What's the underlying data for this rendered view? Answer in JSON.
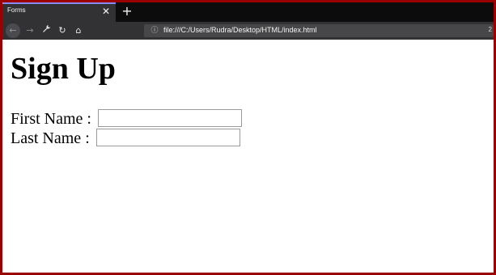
{
  "browser": {
    "tab": {
      "title": "Forms",
      "close_glyph": "✕"
    },
    "new_tab_glyph": "+",
    "nav": {
      "back_icon": "←",
      "forward_icon": "→",
      "tools_icon": "🔧",
      "reload_icon": "↻",
      "home_icon": "⌂"
    },
    "address_bar": {
      "info_icon": "ⓘ",
      "url": "file:///C:/Users/Rudra/Desktop/HTML/index.html",
      "edge_text": "2"
    }
  },
  "page": {
    "heading": "Sign Up",
    "fields": [
      {
        "label": "First Name :",
        "value": ""
      },
      {
        "label": "Last Name :",
        "value": ""
      }
    ]
  },
  "colors": {
    "frame": "#9b0000",
    "tabstrip": "#0c0c0d",
    "toolbar": "#323234",
    "urlbar": "#474749"
  }
}
